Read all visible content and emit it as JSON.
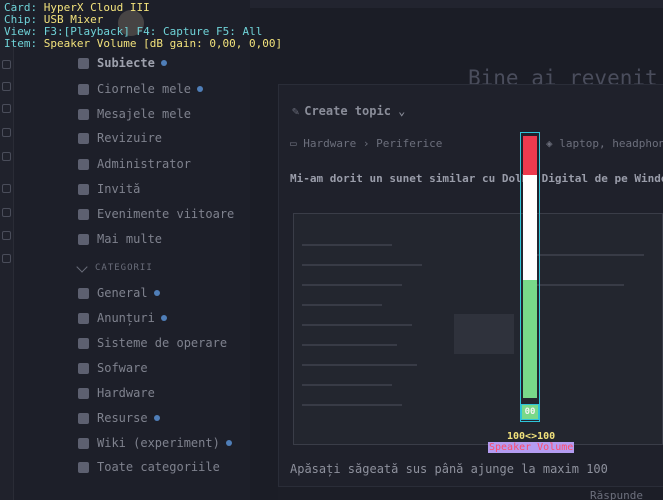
{
  "overlay": {
    "card_label": "Card:",
    "card_value": "HyperX Cloud III",
    "chip_label": "Chip:",
    "chip_value": "USB Mixer",
    "view_label": "View:",
    "view_f3": "F3:[Playback]",
    "view_f4": "F4: Capture",
    "view_f5": "F5: All",
    "item_label": "Item:",
    "item_value": "Speaker Volume [dB gain: 0,00, 0,00]"
  },
  "mixer": {
    "colors": {
      "red": "#ec3a4e",
      "white": "#ffffff",
      "green": "#79d989",
      "frame": "#2ec4d8"
    },
    "level_percent": 100,
    "db_badge": "00",
    "volume_readout": "100<>100",
    "control_name": "Speaker Volume"
  },
  "sidebar": {
    "items": [
      {
        "label": "Subiecte",
        "icon": "layers-icon",
        "dot": true,
        "active": true
      },
      {
        "label": "Ciornele mele",
        "icon": "user-icon",
        "dot": true
      },
      {
        "label": "Mesajele mele",
        "icon": "inbox-icon",
        "dot": false
      },
      {
        "label": "Revizuire",
        "icon": "flag-icon",
        "dot": false
      },
      {
        "label": "Administrator",
        "icon": "wrench-icon",
        "dot": false
      },
      {
        "label": "Invită",
        "icon": "send-icon",
        "dot": false
      },
      {
        "label": "Evenimente viitoare",
        "icon": "calendar-icon",
        "dot": false
      },
      {
        "label": "Mai multe",
        "icon": "more-vertical-icon",
        "dot": false
      }
    ],
    "categories_title": "CATEGORII",
    "categories": [
      {
        "label": "General",
        "icon": "book-icon",
        "dot": true
      },
      {
        "label": "Anunțuri",
        "icon": "book-icon",
        "dot": true
      },
      {
        "label": "Sisteme de operare",
        "icon": "shield-icon",
        "dot": false
      },
      {
        "label": "Sofware",
        "icon": "puzzle-icon",
        "dot": false
      },
      {
        "label": "Hardware",
        "icon": "monitor-icon",
        "dot": false
      },
      {
        "label": "Resurse",
        "icon": "scroll-icon",
        "dot": true
      },
      {
        "label": "Wiki (experiment)",
        "icon": "books-icon",
        "dot": true
      },
      {
        "label": "Toate categoriile",
        "icon": "list-icon",
        "dot": false
      }
    ]
  },
  "main": {
    "welcome": "Bine ai revenit",
    "create_topic": "Create topic",
    "breadcrumb_category": "Hardware",
    "breadcrumb_sub": "Periferice",
    "tags": "laptop, headphon",
    "topic_text": "Mi-am dorit un sunet similar cu Dolby Digital de pe Window",
    "bottom_text": "Apăsați săgeată sus până ajunge la maxim 100",
    "reply_label": "Răspunde"
  }
}
